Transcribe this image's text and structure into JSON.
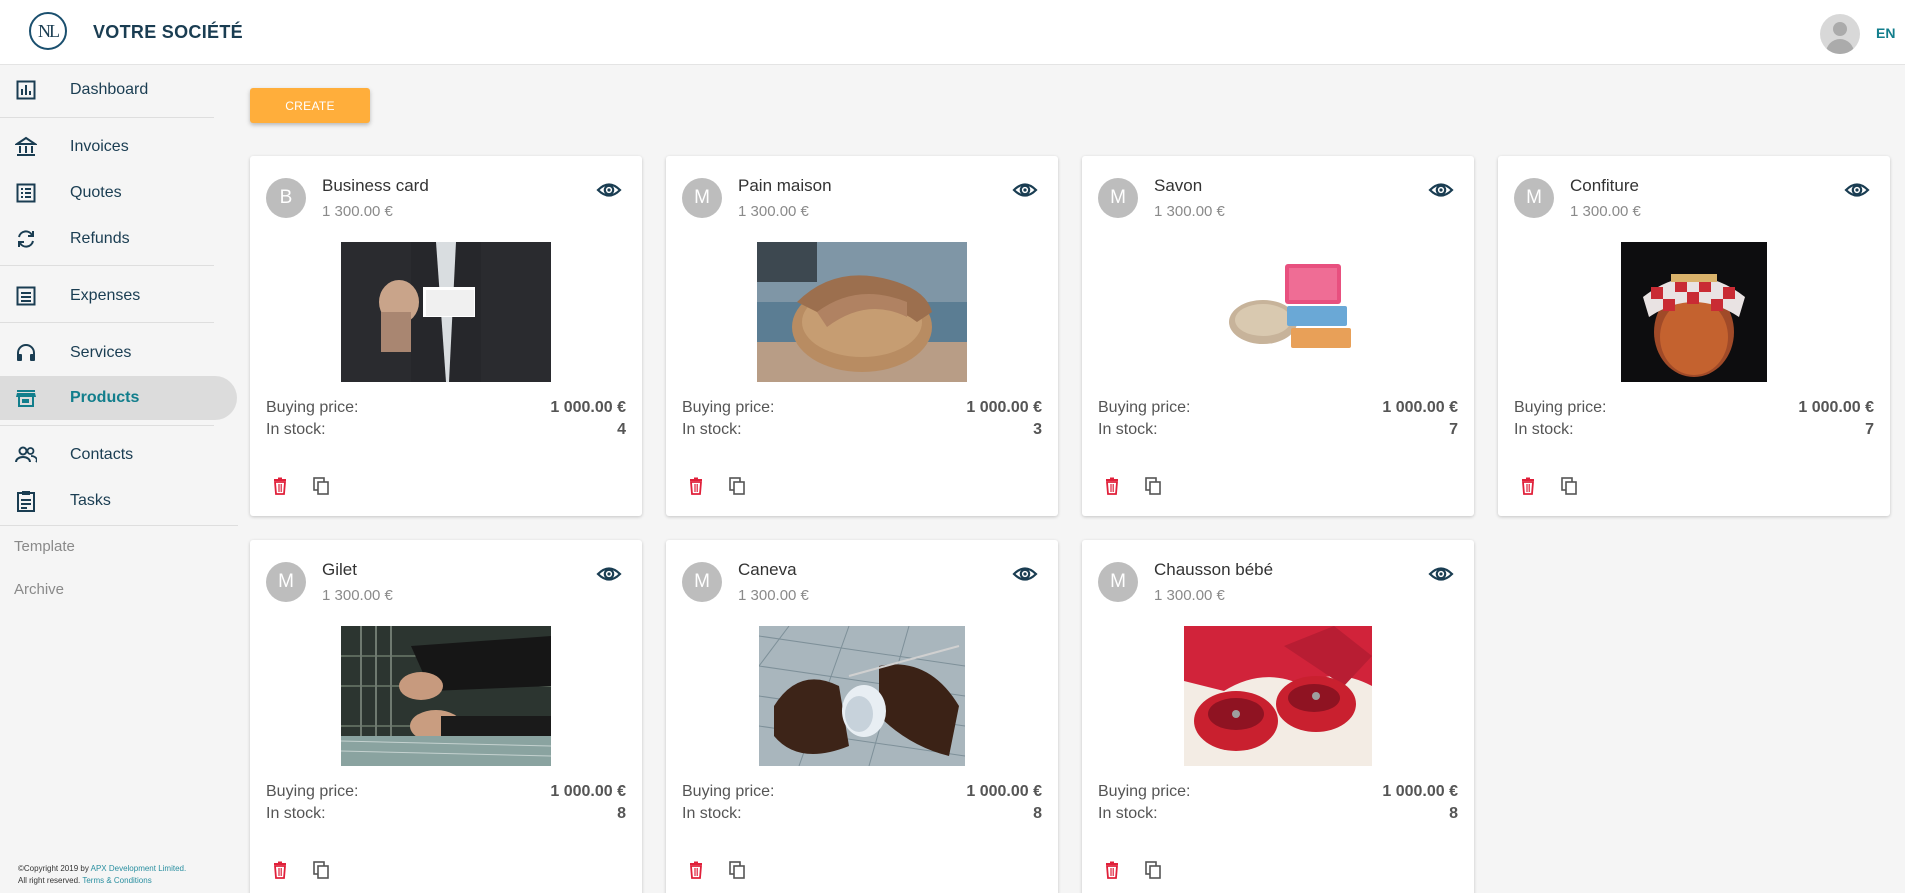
{
  "header": {
    "logo_text": "NL",
    "company": "VOTRE SOCIÉTÉ",
    "lang": "EN"
  },
  "sidebar": {
    "items": [
      {
        "label": "Dashboard",
        "icon": "bar-chart-icon"
      },
      {
        "label": "Invoices",
        "icon": "bank-icon"
      },
      {
        "label": "Quotes",
        "icon": "list-icon"
      },
      {
        "label": "Refunds",
        "icon": "sync-icon"
      },
      {
        "label": "Expenses",
        "icon": "receipt-icon"
      },
      {
        "label": "Services",
        "icon": "headset-icon"
      },
      {
        "label": "Products",
        "icon": "store-icon",
        "active": true
      },
      {
        "label": "Contacts",
        "icon": "people-icon"
      },
      {
        "label": "Tasks",
        "icon": "clipboard-icon"
      }
    ],
    "template": "Template",
    "archive": "Archive",
    "copyright_prefix": "©Copyright 2019 by ",
    "copyright_company": "APX Development Limited.",
    "rights": "All right reserved. ",
    "terms": "Terms & Conditions"
  },
  "toolbar": {
    "create_label": "CREATE"
  },
  "labels": {
    "buying": "Buying price:",
    "stock": "In stock:"
  },
  "products": [
    {
      "initial": "B",
      "name": "Business card",
      "price": "1 300.00 €",
      "buying": "1 000.00 €",
      "stock": "4"
    },
    {
      "initial": "M",
      "name": "Pain maison",
      "price": "1 300.00 €",
      "buying": "1 000.00 €",
      "stock": "3"
    },
    {
      "initial": "M",
      "name": "Savon",
      "price": "1 300.00 €",
      "buying": "1 000.00 €",
      "stock": "7"
    },
    {
      "initial": "M",
      "name": "Confiture",
      "price": "1 300.00 €",
      "buying": "1 000.00 €",
      "stock": "7"
    },
    {
      "initial": "M",
      "name": "Gilet",
      "price": "1 300.00 €",
      "buying": "1 000.00 €",
      "stock": "8"
    },
    {
      "initial": "M",
      "name": "Caneva",
      "price": "1 300.00 €",
      "buying": "1 000.00 €",
      "stock": "8"
    },
    {
      "initial": "M",
      "name": "Chausson bébé",
      "price": "1 300.00 €",
      "buying": "1 000.00 €",
      "stock": "8"
    }
  ],
  "colors": {
    "brand": "#1a3d52",
    "accent": "#127e8c",
    "create": "#ffae3b",
    "delete": "#e0203a"
  }
}
